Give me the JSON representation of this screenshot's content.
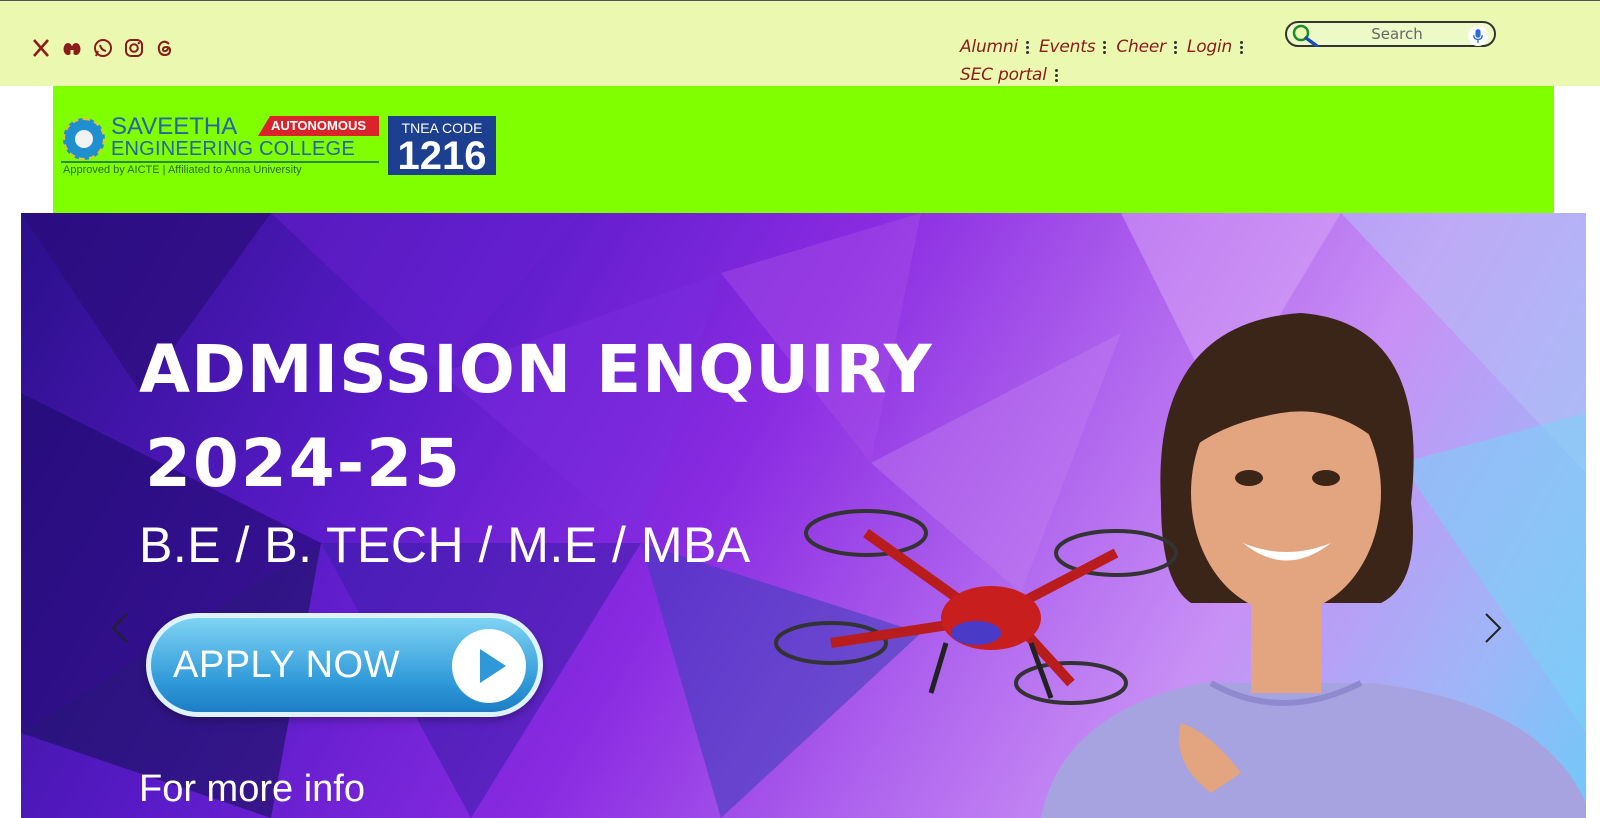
{
  "social": {
    "icons": [
      "x-icon",
      "behance-icon",
      "whatsapp-icon",
      "instagram-icon",
      "threads-icon"
    ],
    "color": "#8a1c1c"
  },
  "nav": {
    "items": [
      {
        "label": "Alumni"
      },
      {
        "label": "Events"
      },
      {
        "label": "Cheer"
      },
      {
        "label": "Login"
      },
      {
        "label": "SEC portal"
      }
    ]
  },
  "search": {
    "placeholder": "Search"
  },
  "logo": {
    "line1": "SAVEETHA",
    "line2": "ENGINEERING COLLEGE",
    "badge": "AUTONOMOUS",
    "tagline": "Approved by AICTE  |  Affiliated to Anna University",
    "tnea_label": "TNEA CODE",
    "tnea_code": "1216"
  },
  "hero": {
    "title": "ADMISSION ENQUIRY",
    "year": "2024-25",
    "courses": "B.E / B. TECH / M.E / MBA",
    "apply_label": "APPLY NOW",
    "more_info": "For more info"
  },
  "colors": {
    "topbar": "#eaf8b0",
    "logo_band": "#80ff00",
    "nav_text": "#8a1c1c",
    "tnea_bg": "#1c3f8f",
    "autonomous_bg": "#d9242b"
  }
}
